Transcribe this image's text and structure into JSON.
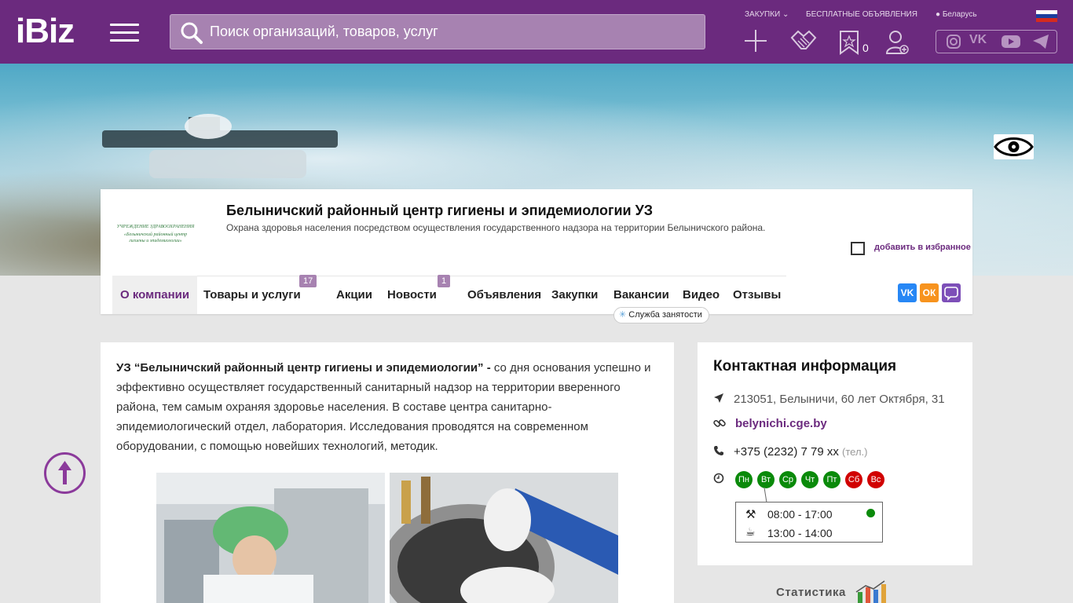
{
  "topbar": {
    "logo": "iBiz",
    "search_placeholder": "Поиск организаций, товаров, услуг",
    "links": {
      "purchases": "ЗАКУПКИ",
      "free_ads": "БЕСПЛАТНЫЕ ОБЪЯВЛЕНИЯ",
      "region": "Беларусь"
    },
    "favorites_count": "0",
    "icons": [
      "plus-icon",
      "handshake-icon",
      "star-icon",
      "add-user-icon"
    ],
    "social": [
      "instagram-icon",
      "vk-icon",
      "youtube-icon",
      "telegram-icon"
    ]
  },
  "company": {
    "title": "Белыничский районный центр гигиены и эпидемиологии УЗ",
    "subtitle": "Охрана здоровья населения посредством осуществления государственного надзора на территории Белыничского района.",
    "add_favorite": "добавить в избранное",
    "logo_lines": [
      "УЧРЕЖДЕНИЕ ЗДРАВООХРАНЕНИЯ",
      "«Белыничский районный центр",
      "гигиены и эпидемиологии»"
    ]
  },
  "tabs": [
    {
      "label": "О компании"
    },
    {
      "label": "Товары и услуги",
      "badge": "17"
    },
    {
      "label": "Акции"
    },
    {
      "label": "Новости",
      "badge": "1"
    },
    {
      "label": "Объявления"
    },
    {
      "label": "Закупки"
    },
    {
      "label": "Вакансии"
    },
    {
      "label": "Видео"
    },
    {
      "label": "Отзывы"
    }
  ],
  "vacancy_hint": "Служба занятости",
  "description": {
    "bold": "УЗ “Белыничский районный центр гигиены и эпидемиологии” -",
    "text": " со дня основания успешно и эффективно осуществляет государственный санитарный надзор на территории вверенного района, тем самым охраняя здоровье населения. В составе центра санитарно-эпидемиологический отдел, лаборатория. Исследования проводятся на современном оборудовании, с помощью новейших технологий, методик."
  },
  "contacts": {
    "title": "Контактная информация",
    "address": "213051, Белыничи, 60 лет Октября, 31",
    "website": "belynichi.cge.by",
    "phone": "+375 (2232) 7 79 xx",
    "phone_type": "(тел.)",
    "days": [
      {
        "label": "Пн",
        "status": "open"
      },
      {
        "label": "Вт",
        "status": "open"
      },
      {
        "label": "Ср",
        "status": "open"
      },
      {
        "label": "Чт",
        "status": "open"
      },
      {
        "label": "Пт",
        "status": "open"
      },
      {
        "label": "Сб",
        "status": "closed"
      },
      {
        "label": "Вс",
        "status": "closed"
      }
    ],
    "work_hours": "08:00 - 17:00",
    "break_hours": "13:00 - 14:00"
  },
  "stats_label": "Статистика",
  "colors": {
    "brand": "#6b2a7e",
    "open": "#0a8a0a",
    "closed": "#d10000"
  }
}
